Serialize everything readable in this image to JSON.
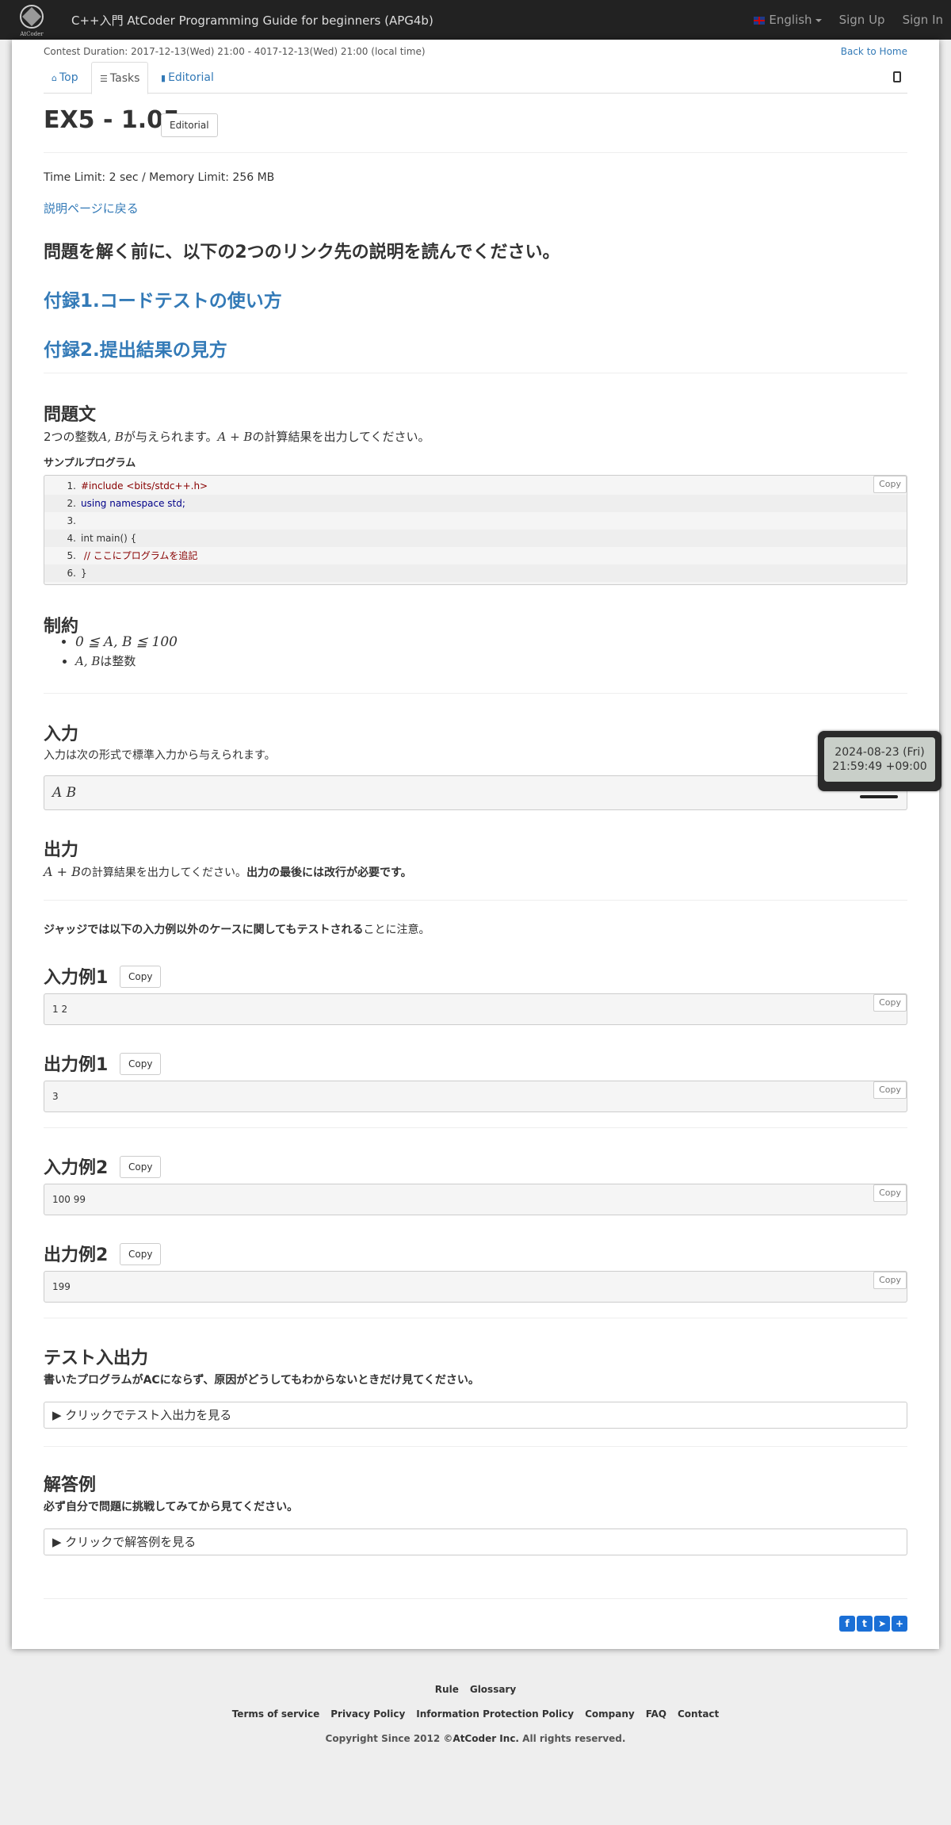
{
  "navbar": {
    "logo_text": "AtCoder",
    "title": "C++入門 AtCoder Programming Guide for beginners (APG4b)",
    "language": "English",
    "sign_up": "Sign Up",
    "sign_in": "Sign In"
  },
  "contest": {
    "duration": "Contest Duration: 2017-12-13(Wed) 21:00 - 4017-12-13(Wed) 21:00 (local time)",
    "back_home": "Back to Home"
  },
  "tabs": [
    {
      "label": "Top"
    },
    {
      "label": "Tasks"
    },
    {
      "label": "Editorial"
    }
  ],
  "task": {
    "title": "EX5 - 1.05",
    "editorial_button": "Editorial",
    "limits": "Time Limit: 2 sec / Memory Limit: 256 MB",
    "back_link": "説明ページに戻る",
    "headline": "問題を解く前に、以下の2つのリンク先の説明を読んでください。",
    "appendix1": "付録1.コードテストの使い方",
    "appendix2": "付録2.提出結果の見方"
  },
  "problem": {
    "heading": "問題文",
    "text_pre": "2つの整数",
    "text_vars": "A, B",
    "text_mid": "が与えられます。",
    "text_expr": "A + B",
    "text_post": "の計算結果を出力してください。",
    "sample_program_label": "サンプルプログラム",
    "code": [
      {
        "num": "1.",
        "text": "#include <bits/stdc++.h>"
      },
      {
        "num": "2.",
        "text": "using namespace std;"
      },
      {
        "num": "3.",
        "text": ""
      },
      {
        "num": "4.",
        "text": "int main() {"
      },
      {
        "num": "5.",
        "text": "  // ここにプログラムを追記"
      },
      {
        "num": "6.",
        "text": "}"
      }
    ],
    "copy": "Copy"
  },
  "constraints": {
    "heading": "制約",
    "item1": "0 ≦ A, B ≦ 100",
    "item2_vars": "A, B",
    "item2_text": "は整数"
  },
  "input": {
    "heading": "入力",
    "text": "入力は次の形式で標準入力から与えられます。",
    "format": "A B"
  },
  "output": {
    "heading": "出力",
    "expr": "A + B",
    "text": "の計算結果を出力してください。",
    "bold": "出力の最後には改行が必要です。"
  },
  "judge_note": {
    "bold": "ジャッジでは以下の入力例以外のケースに関してもテストされる",
    "text": "ことに注意。"
  },
  "samples": [
    {
      "heading": "入力例1",
      "value": "1 2"
    },
    {
      "heading": "出力例1",
      "value": "3"
    },
    {
      "heading": "入力例2",
      "value": "100 99"
    },
    {
      "heading": "出力例2",
      "value": "199"
    }
  ],
  "test_io": {
    "heading": "テスト入出力",
    "note": "書いたプログラムがACにならず、原因がどうしてもわからないときだけ見てください。",
    "toggle": "▶ クリックでテスト入出力を見る"
  },
  "answer": {
    "heading": "解答例",
    "note": "必ず自分で問題に挑戦してみてから見てください。",
    "toggle": "▶ クリックで解答例を見る"
  },
  "clock": {
    "date": "2024-08-23 (Fri)",
    "time": "21:59:49 +09:00"
  },
  "footer": {
    "rule": "Rule",
    "glossary": "Glossary",
    "terms": "Terms of service",
    "privacy": "Privacy Policy",
    "info_protection": "Information Protection Policy",
    "company": "Company",
    "faq": "FAQ",
    "contact": "Contact",
    "copyright_pre": "Copyright Since 2012 ©",
    "copyright_company": "AtCoder Inc.",
    "copyright_post": " All rights reserved."
  },
  "colors": {
    "navbar": "#222222",
    "link": "#337ab7",
    "share": "#1a6fd6"
  }
}
